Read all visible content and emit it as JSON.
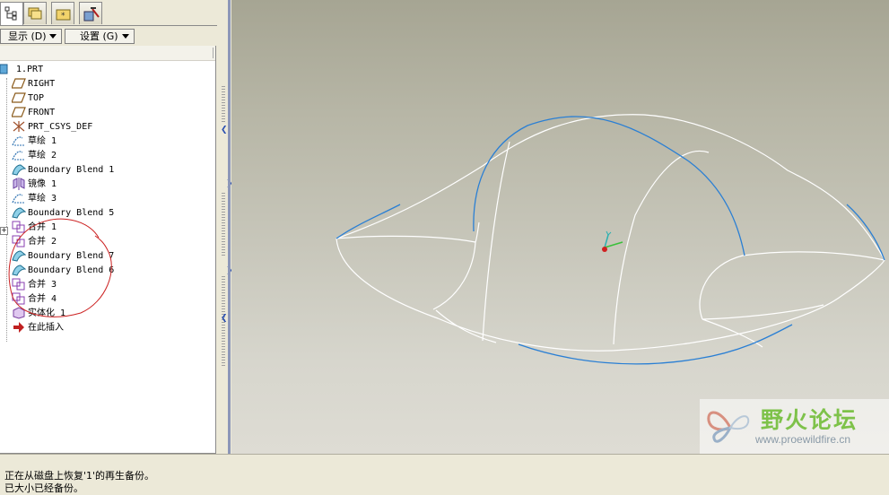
{
  "toolbar": {
    "display_menu_label": "显示 (D)",
    "settings_menu_label": "设置 (G)"
  },
  "tabs": [
    {
      "name": "model-tree-tab",
      "icon": "tree-icon",
      "active": true
    },
    {
      "name": "folder-browser-tab",
      "icon": "folders-icon",
      "active": false
    },
    {
      "name": "favorites-tab",
      "icon": "favorites-folder-icon",
      "active": false
    },
    {
      "name": "connections-tab",
      "icon": "tools-icon",
      "active": false
    }
  ],
  "tree": {
    "root": {
      "label": "1.PRT",
      "icon": "part-icon"
    },
    "items": [
      {
        "label": "RIGHT",
        "icon": "datum-plane-icon"
      },
      {
        "label": "TOP",
        "icon": "datum-plane-icon"
      },
      {
        "label": "FRONT",
        "icon": "datum-plane-icon"
      },
      {
        "label": "PRT_CSYS_DEF",
        "icon": "csys-icon"
      },
      {
        "label": "草绘 1",
        "icon": "sketch-icon"
      },
      {
        "label": "草绘 2",
        "icon": "sketch-icon"
      },
      {
        "label": "Boundary Blend 1",
        "icon": "boundary-blend-icon"
      },
      {
        "label": "镜像 1",
        "icon": "mirror-icon"
      },
      {
        "label": "草绘 3",
        "icon": "sketch-icon"
      },
      {
        "label": "Boundary Blend 5",
        "icon": "boundary-blend-icon"
      },
      {
        "label": "合并 1",
        "icon": "merge-icon"
      },
      {
        "label": "合并 2",
        "icon": "merge-icon"
      },
      {
        "label": "Boundary Blend 7",
        "icon": "boundary-blend-icon"
      },
      {
        "label": "Boundary Blend 6",
        "icon": "boundary-blend-icon"
      },
      {
        "label": "合并 3",
        "icon": "merge-icon"
      },
      {
        "label": "合并 4",
        "icon": "merge-icon"
      },
      {
        "label": "实体化 1",
        "icon": "solidify-icon"
      },
      {
        "label": "在此插入",
        "icon": "insert-here-arrow-icon"
      }
    ]
  },
  "status": {
    "line1": "正在从磁盘上恢复'1'的再生备份。",
    "line2": "已大小已经备份。"
  },
  "watermark": {
    "title": "野火论坛",
    "url": "www.proewildfire.cn"
  },
  "colors": {
    "edge_white": "#ffffff",
    "edge_blue": "#2a7fd4",
    "annotation_red": "#cc2222",
    "watermark_green": "#7ec24a"
  }
}
